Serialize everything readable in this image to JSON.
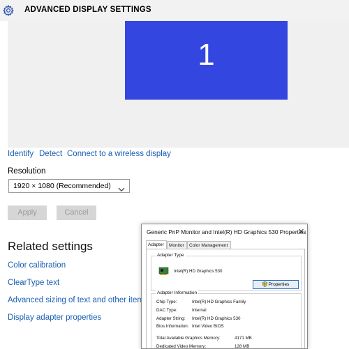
{
  "window": {
    "title": "ADVANCED DISPLAY SETTINGS"
  },
  "preview": {
    "monitor_number": "1",
    "monitor_color": "#3446e0"
  },
  "links": {
    "identify": "Identify",
    "detect": "Detect",
    "connect": "Connect to a wireless display"
  },
  "resolution": {
    "label": "Resolution",
    "value": "1920 × 1080 (Recommended)"
  },
  "buttons": {
    "apply": "Apply",
    "cancel": "Cancel"
  },
  "related": {
    "heading": "Related settings",
    "items": [
      "Color calibration",
      "ClearType text",
      "Advanced sizing of text and other items",
      "Display adapter properties"
    ]
  },
  "dialog": {
    "title": "Generic PnP Monitor and Intel(R) HD Graphics 530 Properties",
    "tabs": [
      "Adapter",
      "Monitor",
      "Color Management"
    ],
    "adapter_type": {
      "title": "Adapter Type",
      "name": "Intel(R) HD Graphics 530",
      "properties_button": "Properties"
    },
    "adapter_info": {
      "title": "Adapter Information",
      "rows": [
        {
          "label": "Chip Type:",
          "value": "Intel(R) HD Graphics Family"
        },
        {
          "label": "DAC Type:",
          "value": "Internal"
        },
        {
          "label": "Adapter String:",
          "value": "Intel(R) HD Graphics 530"
        },
        {
          "label": "Bios Information:",
          "value": "Intel Video BIOS"
        }
      ],
      "memory": [
        {
          "label": "Total Available Graphics Memory:",
          "value": "4171 MB"
        },
        {
          "label": "Dedicated Video Memory:",
          "value": "128 MB"
        }
      ]
    }
  },
  "colors": {
    "link": "#1a5fb4",
    "title_bar": "#f2f2f2",
    "preview_bg": "#f0f0f0"
  },
  "icons": {
    "settings": "gear-icon",
    "dropdown": "chevron-down-icon",
    "adapter": "graphics-card-icon",
    "uac": "shield-icon"
  }
}
